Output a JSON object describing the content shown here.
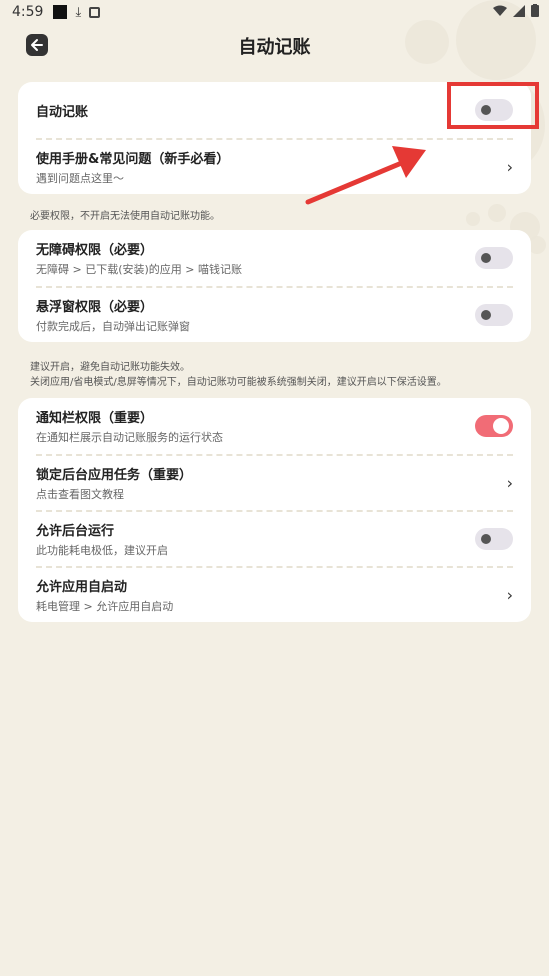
{
  "status_bar": {
    "time": "4:59"
  },
  "header": {
    "title": "自动记账"
  },
  "card1": {
    "items": [
      {
        "title": "自动记账",
        "subtitle": "",
        "action": "toggle",
        "on": false
      },
      {
        "title": "使用手册&常见问题（新手必看）",
        "subtitle": "遇到问题点这里～",
        "action": "chevron"
      }
    ]
  },
  "note1": {
    "text": "必要权限，不开启无法使用自动记账功能。"
  },
  "card2": {
    "items": [
      {
        "title": "无障碍权限（必要）",
        "subtitle": "无障碍 > 已下载(安装)的应用 > 喵钱记账",
        "action": "toggle",
        "on": false
      },
      {
        "title": "悬浮窗权限（必要）",
        "subtitle": "付款完成后，自动弹出记账弹窗",
        "action": "toggle",
        "on": false
      }
    ]
  },
  "note2": {
    "line1": "建议开启，避免自动记账功能失效。",
    "line2": "关闭应用/省电模式/息屏等情况下，自动记账功可能被系统强制关闭，建议开启以下保活设置。"
  },
  "card3": {
    "items": [
      {
        "title": "通知栏权限（重要）",
        "subtitle": "在通知栏展示自动记账服务的运行状态",
        "action": "toggle",
        "on": true
      },
      {
        "title": "锁定后台应用任务（重要）",
        "subtitle": "点击查看图文教程",
        "action": "chevron"
      },
      {
        "title": "允许后台运行",
        "subtitle": "此功能耗电极低，建议开启",
        "action": "toggle",
        "on": false
      },
      {
        "title": "允许应用自启动",
        "subtitle": "耗电管理 > 允许应用自启动",
        "action": "chevron"
      }
    ]
  },
  "colors": {
    "background": "#f3efe4",
    "toggle_on": "#f16c76",
    "annotation": "#e53935"
  },
  "chevron_glyph": "›"
}
